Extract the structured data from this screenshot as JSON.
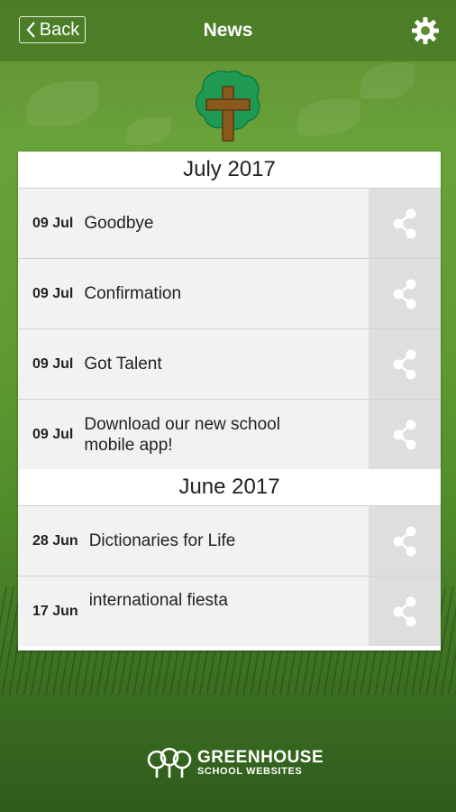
{
  "header": {
    "back_label": "Back",
    "title": "News"
  },
  "sections": [
    {
      "month": "July 2017",
      "items": [
        {
          "date": "09 Jul",
          "title": "Goodbye"
        },
        {
          "date": "09 Jul",
          "title": "Confirmation"
        },
        {
          "date": "09 Jul",
          "title": "Got Talent"
        },
        {
          "date": "09 Jul",
          "title": "Download our new school mobile app!"
        }
      ]
    },
    {
      "month": "June 2017",
      "items": [
        {
          "date": "28 Jun",
          "title": "Dictionaries for Life"
        },
        {
          "date": "17 Jun",
          "title": "international fiesta"
        }
      ]
    }
  ],
  "footer": {
    "brand_line1": "GREENHOUSE",
    "brand_line2": "SCHOOL WEBSITES"
  },
  "icons": {
    "back": "chevron-left-icon",
    "settings": "gear-icon",
    "share": "share-icon",
    "logo": "tree-cross-logo"
  },
  "colors": {
    "background": "#5e9a30",
    "share_bg": "#dedede",
    "row_bg": "#f2f2f2"
  }
}
